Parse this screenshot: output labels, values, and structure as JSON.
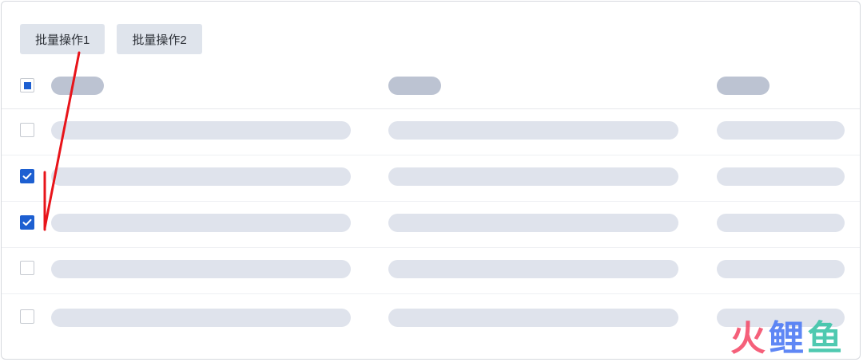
{
  "toolbar": {
    "batch_action_1": "批量操作1",
    "batch_action_2": "批量操作2"
  },
  "table": {
    "select_all_state": "partial",
    "rows": [
      {
        "checked": false
      },
      {
        "checked": true
      },
      {
        "checked": true
      },
      {
        "checked": false
      },
      {
        "checked": false
      }
    ]
  },
  "watermark": {
    "char1": "火",
    "char2": "鲤",
    "char3": "鱼"
  },
  "colors": {
    "accent": "#1d5fd1",
    "annotation": "#e8141a",
    "button_bg": "#dfe4ec",
    "header_placeholder": "#bcc3d2",
    "row_placeholder": "#dfe3ec"
  }
}
